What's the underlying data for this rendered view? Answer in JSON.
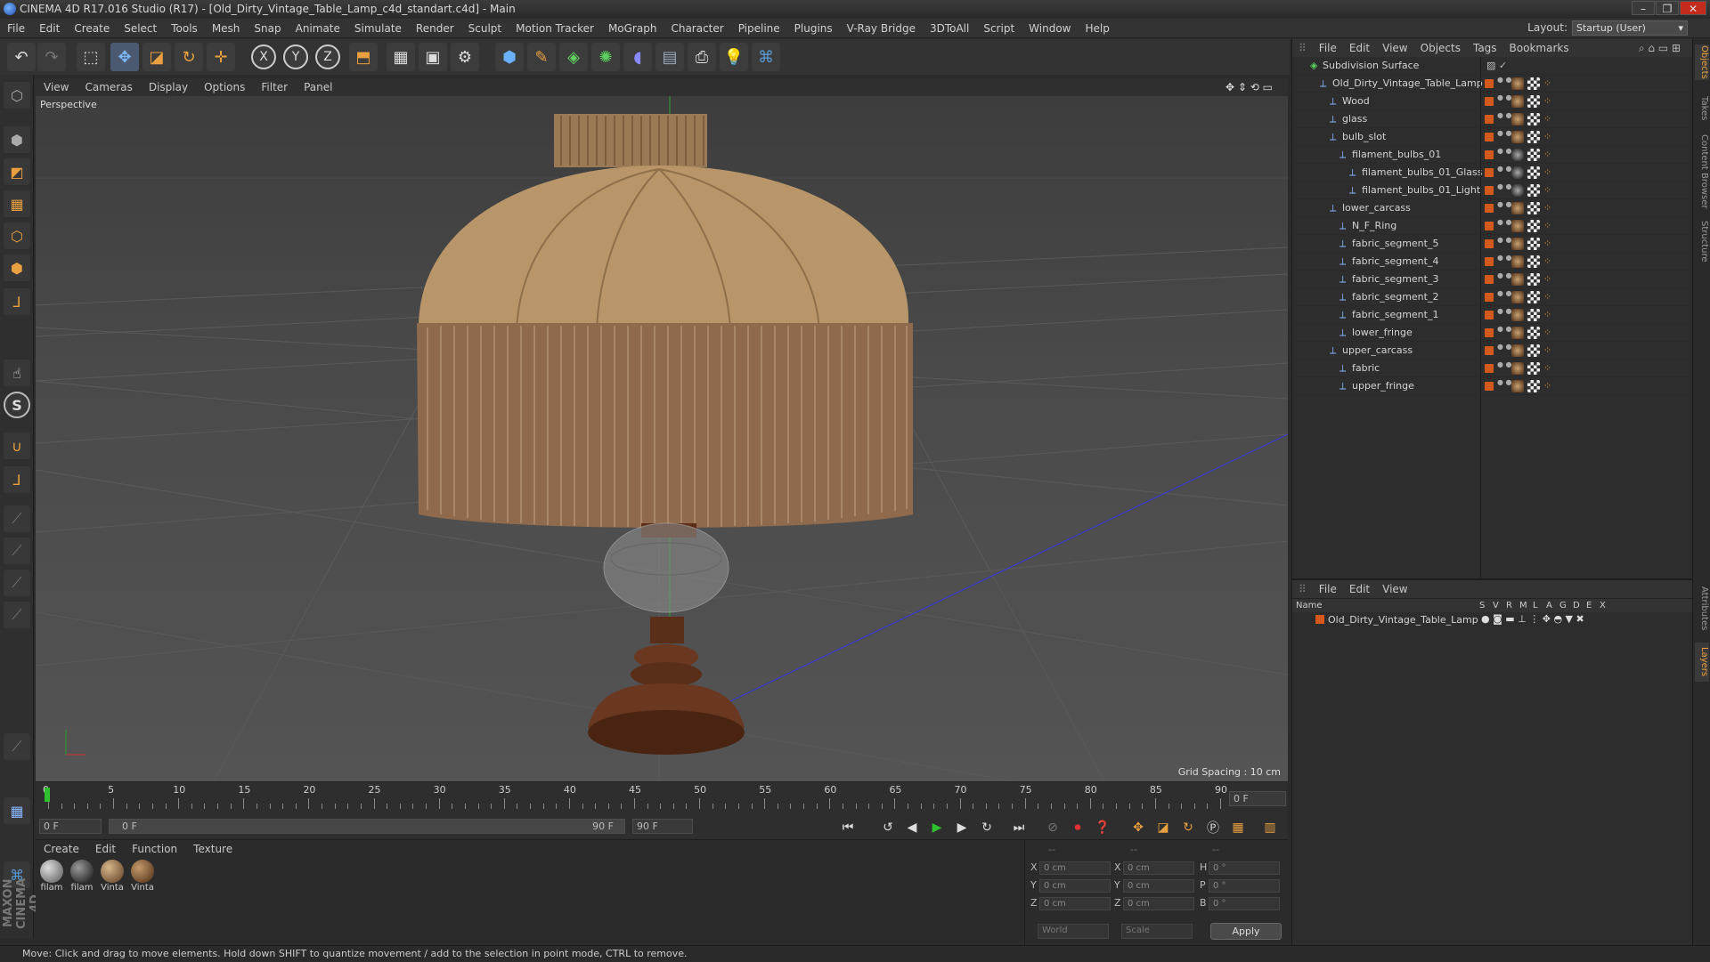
{
  "window": {
    "title": "CINEMA 4D R17.016 Studio (R17) - [Old_Dirty_Vintage_Table_Lamp_c4d_standart.c4d] - Main",
    "controls": [
      "–",
      "❐",
      "✕"
    ]
  },
  "menubar": [
    "File",
    "Edit",
    "Create",
    "Select",
    "Tools",
    "Mesh",
    "Snap",
    "Animate",
    "Simulate",
    "Render",
    "Sculpt",
    "Motion Tracker",
    "MoGraph",
    "Character",
    "Pipeline",
    "Plugins",
    "V-Ray Bridge",
    "3DToAll",
    "Script",
    "Window",
    "Help"
  ],
  "layout": {
    "label": "Layout:",
    "value": "Startup (User)"
  },
  "toolbar_icons": [
    "undo-icon",
    "redo-icon",
    "live-select-icon",
    "move-icon",
    "scale-icon",
    "rotate-icon",
    "move-plus-icon",
    "x-axis-icon",
    "y-axis-icon",
    "z-axis-icon",
    "coordinate-system-icon",
    "render-view-icon",
    "render-picture-viewer-icon",
    "edit-render-settings-icon",
    "cube-icon",
    "pen-spline-icon",
    "subdivision-icon",
    "mograph-cloner-icon",
    "deformer-icon",
    "floor-icon",
    "camera-icon",
    "light-icon",
    "python-icon"
  ],
  "toolbar_glyphs": {
    "x": "X",
    "y": "Y",
    "z": "Z"
  },
  "viewport": {
    "menu": [
      "View",
      "Cameras",
      "Display",
      "Options",
      "Filter",
      "Panel"
    ],
    "label": "Perspective",
    "grid_spacing": "Grid Spacing : 10 cm"
  },
  "timeline": {
    "ticks": [
      "0",
      "5",
      "10",
      "15",
      "20",
      "25",
      "30",
      "35",
      "40",
      "45",
      "50",
      "55",
      "60",
      "65",
      "70",
      "75",
      "80",
      "85",
      "90"
    ],
    "end_field": "0 F",
    "current_frame": "0 F",
    "range_start": "0 F",
    "range_end": "90 F",
    "max_frame": "90 F"
  },
  "materials": {
    "menu": [
      "Create",
      "Edit",
      "Function",
      "Texture"
    ],
    "items": [
      {
        "label": "filam",
        "color": "#8a8a8a"
      },
      {
        "label": "filam",
        "color": "#1a1a1a"
      },
      {
        "label": "Vinta",
        "color": "#8a6a45"
      },
      {
        "label": "Vinta",
        "color": "#6b4a30"
      }
    ]
  },
  "coords": {
    "headers": [
      "--",
      "--",
      "--"
    ],
    "rows": [
      {
        "a": "X",
        "v1": "0 cm",
        "b": "X",
        "v2": "0 cm",
        "c": "H",
        "v3": "0 °"
      },
      {
        "a": "Y",
        "v1": "0 cm",
        "b": "Y",
        "v2": "0 cm",
        "c": "P",
        "v3": "0 °"
      },
      {
        "a": "Z",
        "v1": "0 cm",
        "b": "Z",
        "v2": "0 cm",
        "c": "B",
        "v3": "0 °"
      }
    ],
    "mode1": "World",
    "mode2": "Scale",
    "apply": "Apply"
  },
  "status": "Move: Click and drag to move elements. Hold down SHIFT to quantize movement / add to the selection in point mode, CTRL to remove.",
  "objects": {
    "menu": [
      "File",
      "Edit",
      "View",
      "Objects",
      "Tags",
      "Bookmarks"
    ],
    "tree": [
      {
        "name": "Subdivision Surface",
        "depth": 0
      },
      {
        "name": "Old_Dirty_Vintage_Table_Lamp",
        "depth": 1
      },
      {
        "name": "Wood",
        "depth": 2
      },
      {
        "name": "glass",
        "depth": 2
      },
      {
        "name": "bulb_slot",
        "depth": 2
      },
      {
        "name": "filament_bulbs_01",
        "depth": 3
      },
      {
        "name": "filament_bulbs_01_Glass",
        "depth": 4
      },
      {
        "name": "filament_bulbs_01_Light",
        "depth": 4
      },
      {
        "name": "lower_carcass",
        "depth": 2
      },
      {
        "name": "N_F_Ring",
        "depth": 3
      },
      {
        "name": "fabric_segment_5",
        "depth": 3
      },
      {
        "name": "fabric_segment_4",
        "depth": 3
      },
      {
        "name": "fabric_segment_3",
        "depth": 3
      },
      {
        "name": "fabric_segment_2",
        "depth": 3
      },
      {
        "name": "fabric_segment_1",
        "depth": 3
      },
      {
        "name": "lower_fringe",
        "depth": 3
      },
      {
        "name": "upper_carcass",
        "depth": 2
      },
      {
        "name": "fabric",
        "depth": 3
      },
      {
        "name": "upper_fringe",
        "depth": 3
      }
    ]
  },
  "layers": {
    "menu": [
      "File",
      "Edit",
      "View"
    ],
    "columns": [
      "Name",
      "S",
      "V",
      "R",
      "M",
      "L",
      "A",
      "G",
      "D",
      "E",
      "X"
    ],
    "rows": [
      "Old_Dirty_Vintage_Table_Lamp"
    ]
  },
  "right_tabs": [
    "Objects",
    "Takes",
    "Content Browser",
    "Structure",
    "Attributes",
    "Layers"
  ],
  "left_tool_icons": [
    "model-mode-icon",
    "texture-mode-icon",
    "workplane-icon",
    "points-mode-icon",
    "edges-mode-icon",
    "polygons-mode-icon",
    "axis-mode-icon",
    "tweak-mode-icon",
    "solo-icon",
    "magnet-icon",
    "snap-icon",
    "knife-icon",
    "bridge-icon",
    "extrude-icon",
    "brush-icon",
    "sculpt-icon",
    "grid-icon",
    "python-script-icon"
  ],
  "left_tool_glyphs": {
    "solo": "S"
  },
  "brand": "MAXON CINEMA 4D"
}
